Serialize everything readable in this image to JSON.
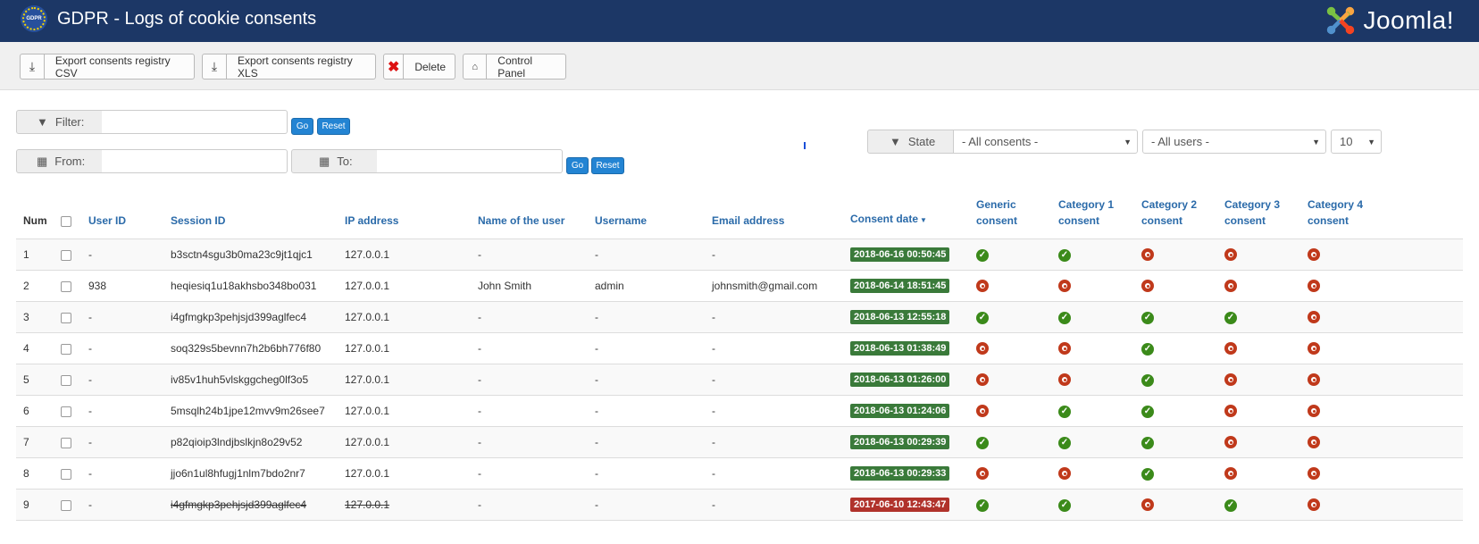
{
  "header": {
    "title": "GDPR - Logs of cookie consents",
    "logo_text": "GDPR",
    "brand": "Joomla!",
    "bg_color": "#1c3766"
  },
  "toolbar": {
    "export_csv": "Export consents registry CSV",
    "export_xls": "Export consents registry XLS",
    "delete": "Delete",
    "control_panel": "Control Panel"
  },
  "filters": {
    "filter_label": "Filter:",
    "from_label": "From:",
    "to_label": "To:",
    "go": "Go",
    "reset": "Reset",
    "state_label": "State",
    "state_value": "- All consents -",
    "users_value": "- All users -",
    "limit_value": "10"
  },
  "columns": {
    "num": "Num",
    "user_id": "User ID",
    "session_id": "Session ID",
    "ip": "IP address",
    "name": "Name of the user",
    "username": "Username",
    "email": "Email address",
    "consent_date": "Consent date",
    "generic1": "Generic",
    "generic2": "consent",
    "cat1_1": "Category 1",
    "cat1_2": "consent",
    "cat2_1": "Category 2",
    "cat2_2": "consent",
    "cat3_1": "Category 3",
    "cat3_2": "consent",
    "cat4_1": "Category 4",
    "cat4_2": "consent"
  },
  "rows": [
    {
      "num": "1",
      "user_id": "-",
      "session": "b3sctn4sgu3b0ma23c9jt1qjc1",
      "ip": "127.0.0.1",
      "name": "-",
      "username": "-",
      "email": "-",
      "date": "2018-06-16 00:50:45",
      "consents": [
        true,
        true,
        false,
        false,
        false
      ]
    },
    {
      "num": "2",
      "user_id": "938",
      "session": "heqiesiq1u18akhsbo348bo031",
      "ip": "127.0.0.1",
      "name": "John Smith",
      "username": "admin",
      "email": "johnsmith@gmail.com",
      "date": "2018-06-14 18:51:45",
      "consents": [
        false,
        false,
        false,
        false,
        false
      ]
    },
    {
      "num": "3",
      "user_id": "-",
      "session": "i4gfmgkp3pehjsjd399aglfec4",
      "ip": "127.0.0.1",
      "name": "-",
      "username": "-",
      "email": "-",
      "date": "2018-06-13 12:55:18",
      "consents": [
        true,
        true,
        true,
        true,
        false
      ]
    },
    {
      "num": "4",
      "user_id": "-",
      "session": "soq329s5bevnn7h2b6bh776f80",
      "ip": "127.0.0.1",
      "name": "-",
      "username": "-",
      "email": "-",
      "date": "2018-06-13 01:38:49",
      "consents": [
        false,
        false,
        true,
        false,
        false
      ]
    },
    {
      "num": "5",
      "user_id": "-",
      "session": "iv85v1huh5vlskggcheg0lf3o5",
      "ip": "127.0.0.1",
      "name": "-",
      "username": "-",
      "email": "-",
      "date": "2018-06-13 01:26:00",
      "consents": [
        false,
        false,
        true,
        false,
        false
      ]
    },
    {
      "num": "6",
      "user_id": "-",
      "session": "5msqlh24b1jpe12mvv9m26see7",
      "ip": "127.0.0.1",
      "name": "-",
      "username": "-",
      "email": "-",
      "date": "2018-06-13 01:24:06",
      "consents": [
        false,
        true,
        true,
        false,
        false
      ]
    },
    {
      "num": "7",
      "user_id": "-",
      "session": "p82qioip3lndjbslkjn8o29v52",
      "ip": "127.0.0.1",
      "name": "-",
      "username": "-",
      "email": "-",
      "date": "2018-06-13 00:29:39",
      "consents": [
        true,
        true,
        true,
        false,
        false
      ]
    },
    {
      "num": "8",
      "user_id": "-",
      "session": "jjo6n1ul8hfugj1nlm7bdo2nr7",
      "ip": "127.0.0.1",
      "name": "-",
      "username": "-",
      "email": "-",
      "date": "2018-06-13 00:29:33",
      "consents": [
        false,
        false,
        true,
        false,
        false
      ]
    },
    {
      "num": "9",
      "user_id": "-",
      "session": "i4gfmgkp3pehjsjd399aglfec4",
      "ip": "127.0.0.1",
      "name": "-",
      "username": "-",
      "email": "-",
      "date": "2017-06-10 12:43:47",
      "consents": [
        true,
        true,
        false,
        true,
        false
      ],
      "expired": true
    }
  ],
  "colors": {
    "date_valid": "#3a7a3a",
    "date_expired": "#b0322b",
    "consent_yes": "#3b8a1a",
    "consent_no": "#c0391b",
    "link": "#2a6aa9"
  },
  "icons": {
    "consent_yes": "check-circle-icon",
    "consent_no": "dot-circle-icon"
  }
}
